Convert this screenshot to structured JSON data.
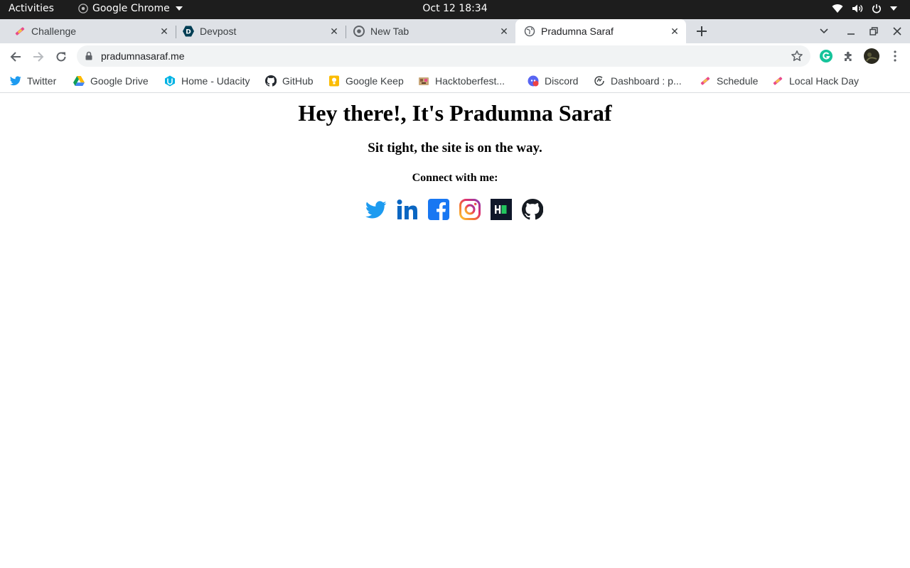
{
  "system": {
    "activities": "Activities",
    "app_name": "Google Chrome",
    "clock": "Oct 12  18:34"
  },
  "tabs": [
    {
      "title": "Challenge",
      "icon": "hacktoberfest-favicon",
      "active": false
    },
    {
      "title": "Devpost",
      "icon": "devpost-favicon",
      "active": false
    },
    {
      "title": "New Tab",
      "icon": "chrome-favicon",
      "active": false
    },
    {
      "title": "Pradumna Saraf",
      "icon": "globe-favicon",
      "active": true
    }
  ],
  "toolbar": {
    "url": "pradumnasaraf.me"
  },
  "bookmarks": [
    {
      "label": "Twitter",
      "icon": "twitter-icon"
    },
    {
      "label": "Google Drive",
      "icon": "google-drive-icon"
    },
    {
      "label": "Home - Udacity",
      "icon": "udacity-icon"
    },
    {
      "label": "GitHub",
      "icon": "github-icon"
    },
    {
      "label": "Google Keep",
      "icon": "google-keep-icon"
    },
    {
      "label": "Hacktoberfest...",
      "icon": "hacktoberfest-icon"
    },
    {
      "label": "Discord",
      "icon": "discord-icon"
    },
    {
      "label": "Dashboard : p...",
      "icon": "dashboard-icon"
    },
    {
      "label": "Schedule",
      "icon": "hacktoberfest-icon"
    },
    {
      "label": "Local Hack Day",
      "icon": "hacktoberfest-icon"
    }
  ],
  "page": {
    "heading": "Hey there!, It's Pradumna Saraf",
    "subheading": "Sit tight, the site is on the way.",
    "connect_label": "Connect with me:",
    "socials": [
      "twitter",
      "linkedin",
      "facebook",
      "instagram",
      "hashnode",
      "github"
    ]
  },
  "colors": {
    "twitter": "#1d9bf0",
    "linkedin": "#0a66c2",
    "facebook": "#1877f2",
    "hashnode": "#0f172a",
    "hashnode_accent": "#22c55e",
    "github": "#161b22"
  }
}
